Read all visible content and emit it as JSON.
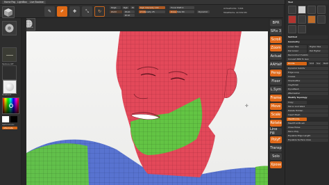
{
  "top_tabs": [
    "Home Page",
    "LightBox",
    "Live Boolean"
  ],
  "toolbar": {
    "buttons": [
      {
        "label": "Edit",
        "glyph": "✎"
      },
      {
        "label": "Draw",
        "glyph": "✐"
      },
      {
        "label": "Move",
        "glyph": "✥"
      },
      {
        "label": "Scale",
        "glyph": "⤡"
      },
      {
        "label": "Rotate",
        "glyph": "↻"
      }
    ],
    "mrgb_label": "Mrgb",
    "rgb_label": "Rgb",
    "m_label": "M",
    "zadd_label": "Zadd",
    "zsub_label": "Zsub",
    "zcut_label": "Zcut",
    "focal_label": "Focal Shift 0",
    "draw_size_label": "Draw Size 64",
    "rgb_intensity_label": "Rgb Intensity 100",
    "z_intensity_label": "Z Intensity 25",
    "active_points": "ActivePoints: 7,641",
    "total_points": "TotalPoints: 22,532 Mil",
    "dynamic_label": "Dynamic"
  },
  "left_tray": {
    "material_label": "MatCap Gray",
    "texture_label": "Texture Off",
    "alpha_label": "Alpha Off",
    "gradient_label": "Gradient",
    "switch_color_label": "SwitchColor",
    "alternate_label": "Alternate",
    "thumb_caption": "PolySphere"
  },
  "right_strip": [
    {
      "label": "BPR",
      "active": false
    },
    {
      "label": "SPix 3",
      "active": false
    },
    {
      "label": "Scroll",
      "active": true
    },
    {
      "label": "Zoom",
      "active": true
    },
    {
      "label": "Actual",
      "active": false
    },
    {
      "label": "AAHalf",
      "active": false
    },
    {
      "label": "Persp",
      "active": true
    },
    {
      "label": "Floor",
      "active": false
    },
    {
      "label": "L.Sym",
      "active": false
    },
    {
      "label": "Frame",
      "active": true
    },
    {
      "label": "Move",
      "active": true
    },
    {
      "label": "Scale",
      "active": true
    },
    {
      "label": "Rotate",
      "active": true
    },
    {
      "label": "Line Fill",
      "active": false
    },
    {
      "label": "PolyF",
      "active": true
    },
    {
      "label": "Transp",
      "active": false
    },
    {
      "label": "Solo",
      "active": false
    },
    {
      "label": "Xpose",
      "active": true
    }
  ],
  "right_panel": {
    "title": "Tool",
    "subtool_header": "Subtool",
    "geometry_header": "Geometry",
    "rows": [
      "Lower Res",
      "Higher Res",
      "Del Lower",
      "Del Higher",
      "Reconstruct Subdiv",
      "Convert BPR To Geo",
      "Divide",
      "Smt",
      "Suv",
      "ReUV",
      "Dynamic Subdiv",
      "Edge Loop",
      "Crease",
      "ShadowBox",
      "ClayPolish",
      "DynaMesh",
      "ZRemesher",
      "Modify Topology",
      "Copy",
      "Mirror And Weld",
      "Delete Hidden",
      "Insert Mesh",
      "WeldPoints",
      "MeshFromBrush",
      "Close Holes",
      "Micro Poly",
      "Equalize Edge Length",
      "Equalize Surface Area"
    ]
  },
  "colors": {
    "accent": "#e0691a",
    "red_poly": "#e3495a",
    "green_poly": "#63c444",
    "blue_poly": "#5873d0"
  }
}
